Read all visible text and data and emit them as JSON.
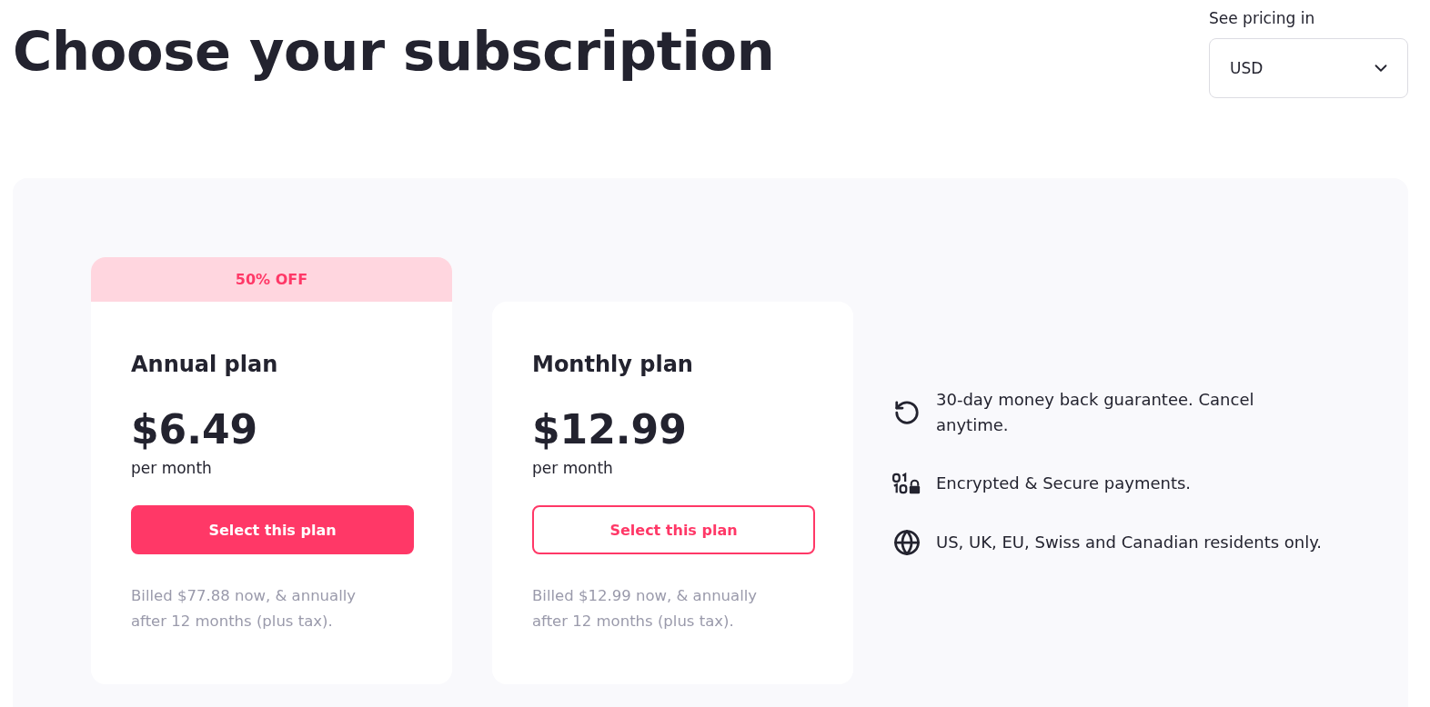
{
  "header": {
    "title": "Choose your subscription"
  },
  "currency": {
    "label": "See pricing in",
    "value": "USD"
  },
  "plans": [
    {
      "badge": "50% OFF",
      "name": "Annual plan",
      "price": "$6.49",
      "period": "per month",
      "button": {
        "label": "Select this plan",
        "kind": "filled"
      },
      "note": "Billed $77.88 now, & annually after 12 months (plus tax)."
    },
    {
      "name": "Monthly plan",
      "price": "$12.99",
      "period": "per month",
      "button": {
        "label": "Select this plan",
        "kind": "outline"
      },
      "note": "Billed $12.99 now, & annually after 12 months (plus tax)."
    }
  ],
  "features": [
    {
      "kind": "refund",
      "text": "30-day money back guarantee. Cancel anytime."
    },
    {
      "kind": "secure",
      "text": "Encrypted & Secure payments."
    },
    {
      "kind": "region",
      "text": "US, UK, EU, Swiss and Canadian residents only."
    }
  ]
}
